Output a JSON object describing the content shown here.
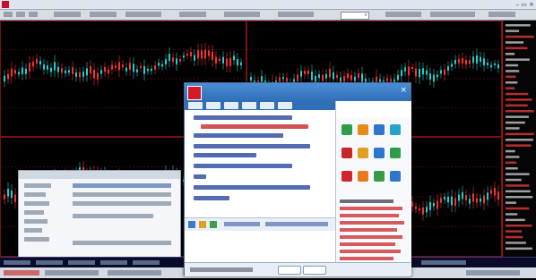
{
  "app": {
    "title": ""
  },
  "popup": {
    "brand": "",
    "right_panel_title": "",
    "close_glyph": "×"
  },
  "colors": {
    "chart_bg": "#000000",
    "up": "#ff3030",
    "down": "#20d0d0",
    "grid": "#7a1010",
    "popup_header": "#2f6fb6"
  },
  "icons": [
    "app-logo-icon",
    "search-icon",
    "close-icon",
    "popup-logo-icon"
  ]
}
